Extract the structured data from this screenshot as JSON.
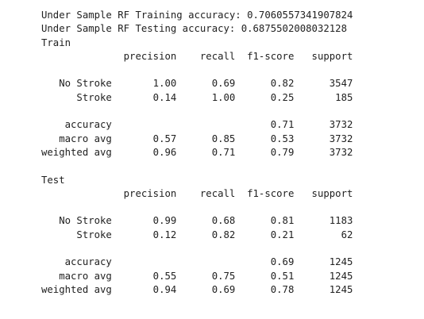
{
  "output": {
    "lines": [
      "Under Sample RF Training accuracy: 0.7060557341907824",
      "Under Sample RF Testing accuracy: 0.6875502008032128",
      "Train",
      "              precision    recall  f1-score   support",
      "",
      "   No Stroke       1.00      0.69      0.82      3547",
      "      Stroke       0.14      1.00      0.25       185",
      "",
      "    accuracy                           0.71      3732",
      "   macro avg       0.57      0.85      0.53      3732",
      "weighted avg       0.96      0.71      0.79      3732",
      "",
      "Test",
      "              precision    recall  f1-score   support",
      "",
      "   No Stroke       0.99      0.68      0.81      1183",
      "      Stroke       0.12      0.82      0.21        62",
      "",
      "    accuracy                           0.69      1245",
      "   macro avg       0.55      0.75      0.51      1245",
      "weighted avg       0.94      0.69      0.78      1245"
    ]
  }
}
